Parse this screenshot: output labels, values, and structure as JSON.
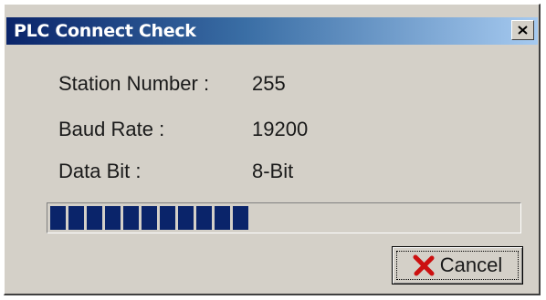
{
  "window": {
    "title": "PLC Connect Check"
  },
  "fields": [
    {
      "label": "Station Number :",
      "value": "255"
    },
    {
      "label": "Baud Rate :",
      "value": "19200"
    },
    {
      "label": "Data Bit :",
      "value": "8-Bit"
    }
  ],
  "progress": {
    "percent": 43,
    "color": "#0a246a"
  },
  "buttons": {
    "cancel_label": "Cancel"
  },
  "icons": {
    "close": "close-icon",
    "cancel": "red-x-icon"
  },
  "colors": {
    "titlebar_start": "#0a246a",
    "titlebar_end": "#a6caf0",
    "dialog_bg": "#d4d0c8",
    "cancel_icon": "#cc1010"
  }
}
